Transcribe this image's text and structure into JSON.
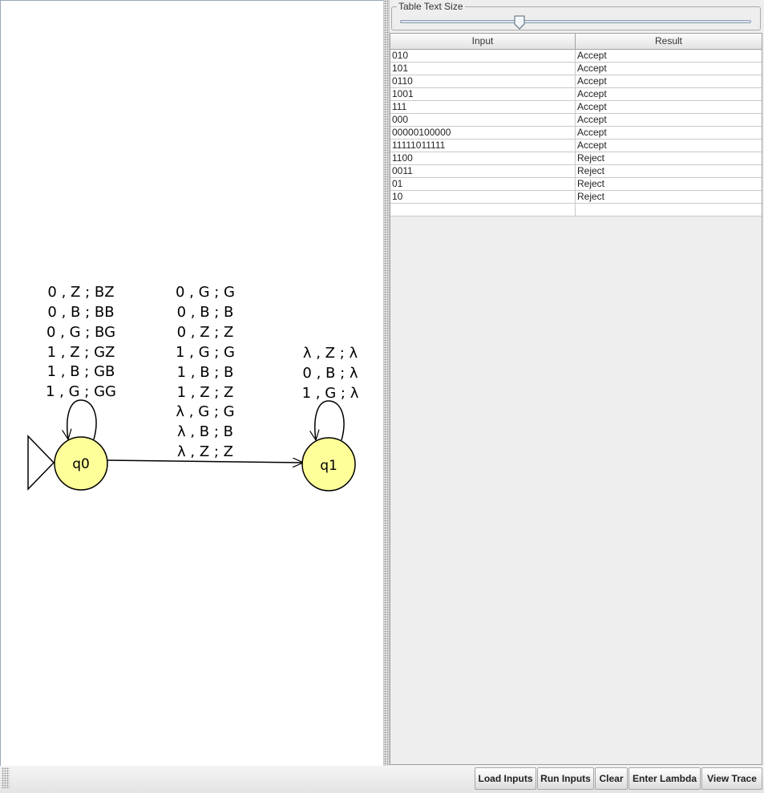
{
  "automaton": {
    "states": [
      {
        "name": "q0",
        "initial": true,
        "final": false
      },
      {
        "name": "q1",
        "initial": false,
        "final": false
      }
    ],
    "loop_q0_labels": [
      "0 , Z ; BZ",
      "0 , B ; BB",
      "0 , G ; BG",
      "1 , Z ; GZ",
      "1 , B ; GB",
      "1 , G ; GG"
    ],
    "edge_q0_q1_labels": [
      "0 , G ; G",
      "0 , B ; B",
      "0 , Z ; Z",
      "1 , G ; G",
      "1 , B ; B",
      "1 , Z ; Z",
      "λ , G ; G",
      "λ , B ; B",
      "λ , Z ; Z"
    ],
    "loop_q1_labels": [
      "λ , Z ; λ",
      "0 , B ; λ",
      "1 , G ; λ"
    ],
    "state_color": "#ffff99"
  },
  "slider": {
    "title": "Table Text Size",
    "value_fraction": 0.34
  },
  "table": {
    "headers": {
      "input": "Input",
      "result": "Result"
    },
    "rows": [
      {
        "input": "010",
        "result": "Accept"
      },
      {
        "input": "101",
        "result": "Accept"
      },
      {
        "input": "0110",
        "result": "Accept"
      },
      {
        "input": "1001",
        "result": "Accept"
      },
      {
        "input": "111",
        "result": "Accept"
      },
      {
        "input": "000",
        "result": "Accept"
      },
      {
        "input": "00000100000",
        "result": "Accept"
      },
      {
        "input": "11111011111",
        "result": "Accept"
      },
      {
        "input": "1100",
        "result": "Reject"
      },
      {
        "input": "0011",
        "result": "Reject"
      },
      {
        "input": "01",
        "result": "Reject"
      },
      {
        "input": "10",
        "result": "Reject"
      },
      {
        "input": "",
        "result": ""
      }
    ]
  },
  "buttons": {
    "load_inputs": "Load Inputs",
    "run_inputs": "Run Inputs",
    "clear": "Clear",
    "enter_lambda": "Enter Lambda",
    "view_trace": "View Trace"
  }
}
